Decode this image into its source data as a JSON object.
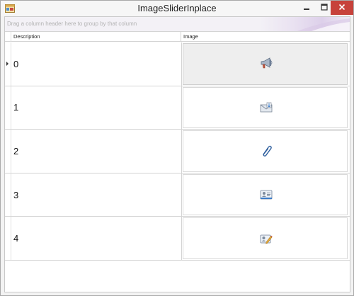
{
  "window": {
    "title": "ImageSliderInplace",
    "icon": "form-icon",
    "controls": [
      "minimize-icon",
      "maximize-icon",
      "close-icon"
    ]
  },
  "grid": {
    "group_panel_hint": "Drag a column header here to group by that column",
    "columns": [
      {
        "label": "Description"
      },
      {
        "label": "Image"
      }
    ],
    "rows": [
      {
        "description": "0",
        "icon": "megaphone-icon",
        "selected": true
      },
      {
        "description": "1",
        "icon": "mail-receive-icon",
        "selected": false
      },
      {
        "description": "2",
        "icon": "paperclip-icon",
        "selected": false
      },
      {
        "description": "3",
        "icon": "contact-card-icon",
        "selected": false
      },
      {
        "description": "4",
        "icon": "edit-contact-icon",
        "selected": false
      }
    ]
  }
}
